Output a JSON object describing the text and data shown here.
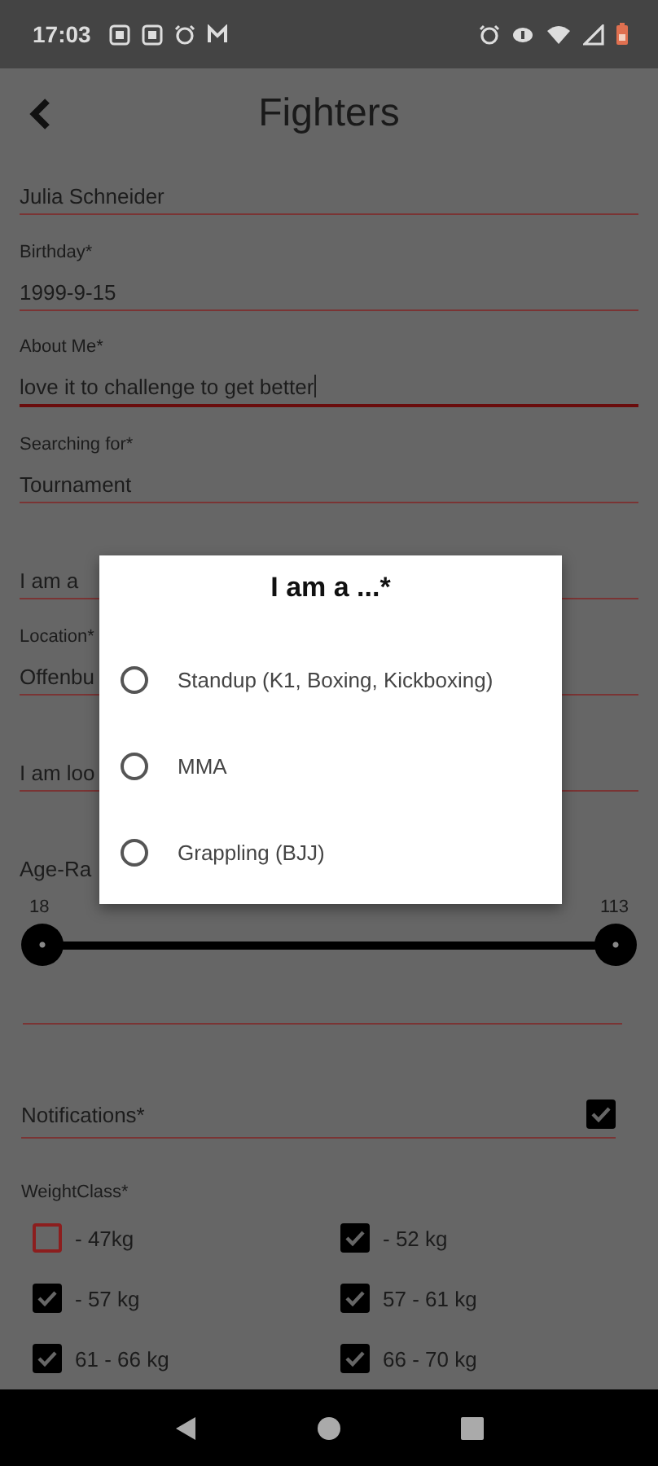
{
  "status_bar": {
    "time": "17:03"
  },
  "header": {
    "title": "Fighters"
  },
  "fields": [
    {
      "value": "Julia Schneider",
      "focused": false
    },
    {
      "label": "Birthday*",
      "value": "1999-9-15",
      "focused": false
    },
    {
      "label": "About Me*",
      "value": "love it to challenge to get better",
      "focused": true
    },
    {
      "label": "Searching for*",
      "value": "Tournament",
      "focused": false
    },
    {
      "placeholder": "I am a",
      "focused": false
    },
    {
      "label": "Location*",
      "value": "Offenbu",
      "focused": false
    },
    {
      "placeholder": "I am loo",
      "focused": false
    }
  ],
  "age_range": {
    "label": "Age-Ra",
    "min_label": "18",
    "max_label": "113",
    "thumbs": [
      {
        "level": 0
      },
      {
        "level": 1
      }
    ]
  },
  "notifications": {
    "label": "Notifications*",
    "checked": true
  },
  "weight_class": {
    "label": "WeightClass*",
    "options": [
      {
        "label": "- 47kg",
        "checked": false
      },
      {
        "label": "- 52 kg",
        "checked": true
      },
      {
        "label": "- 57 kg",
        "checked": true
      },
      {
        "label": "57 - 61 kg",
        "checked": true
      },
      {
        "label": "61 - 66 kg",
        "checked": true
      },
      {
        "label": "66 - 70 kg",
        "checked": true
      }
    ]
  },
  "dialog": {
    "title": "I am a ...*",
    "options": [
      {
        "label": "Standup (K1, Boxing, Kickboxing)",
        "selected": false
      },
      {
        "label": "MMA",
        "selected": false
      },
      {
        "label": "Grappling (BJJ)",
        "selected": false
      }
    ]
  }
}
